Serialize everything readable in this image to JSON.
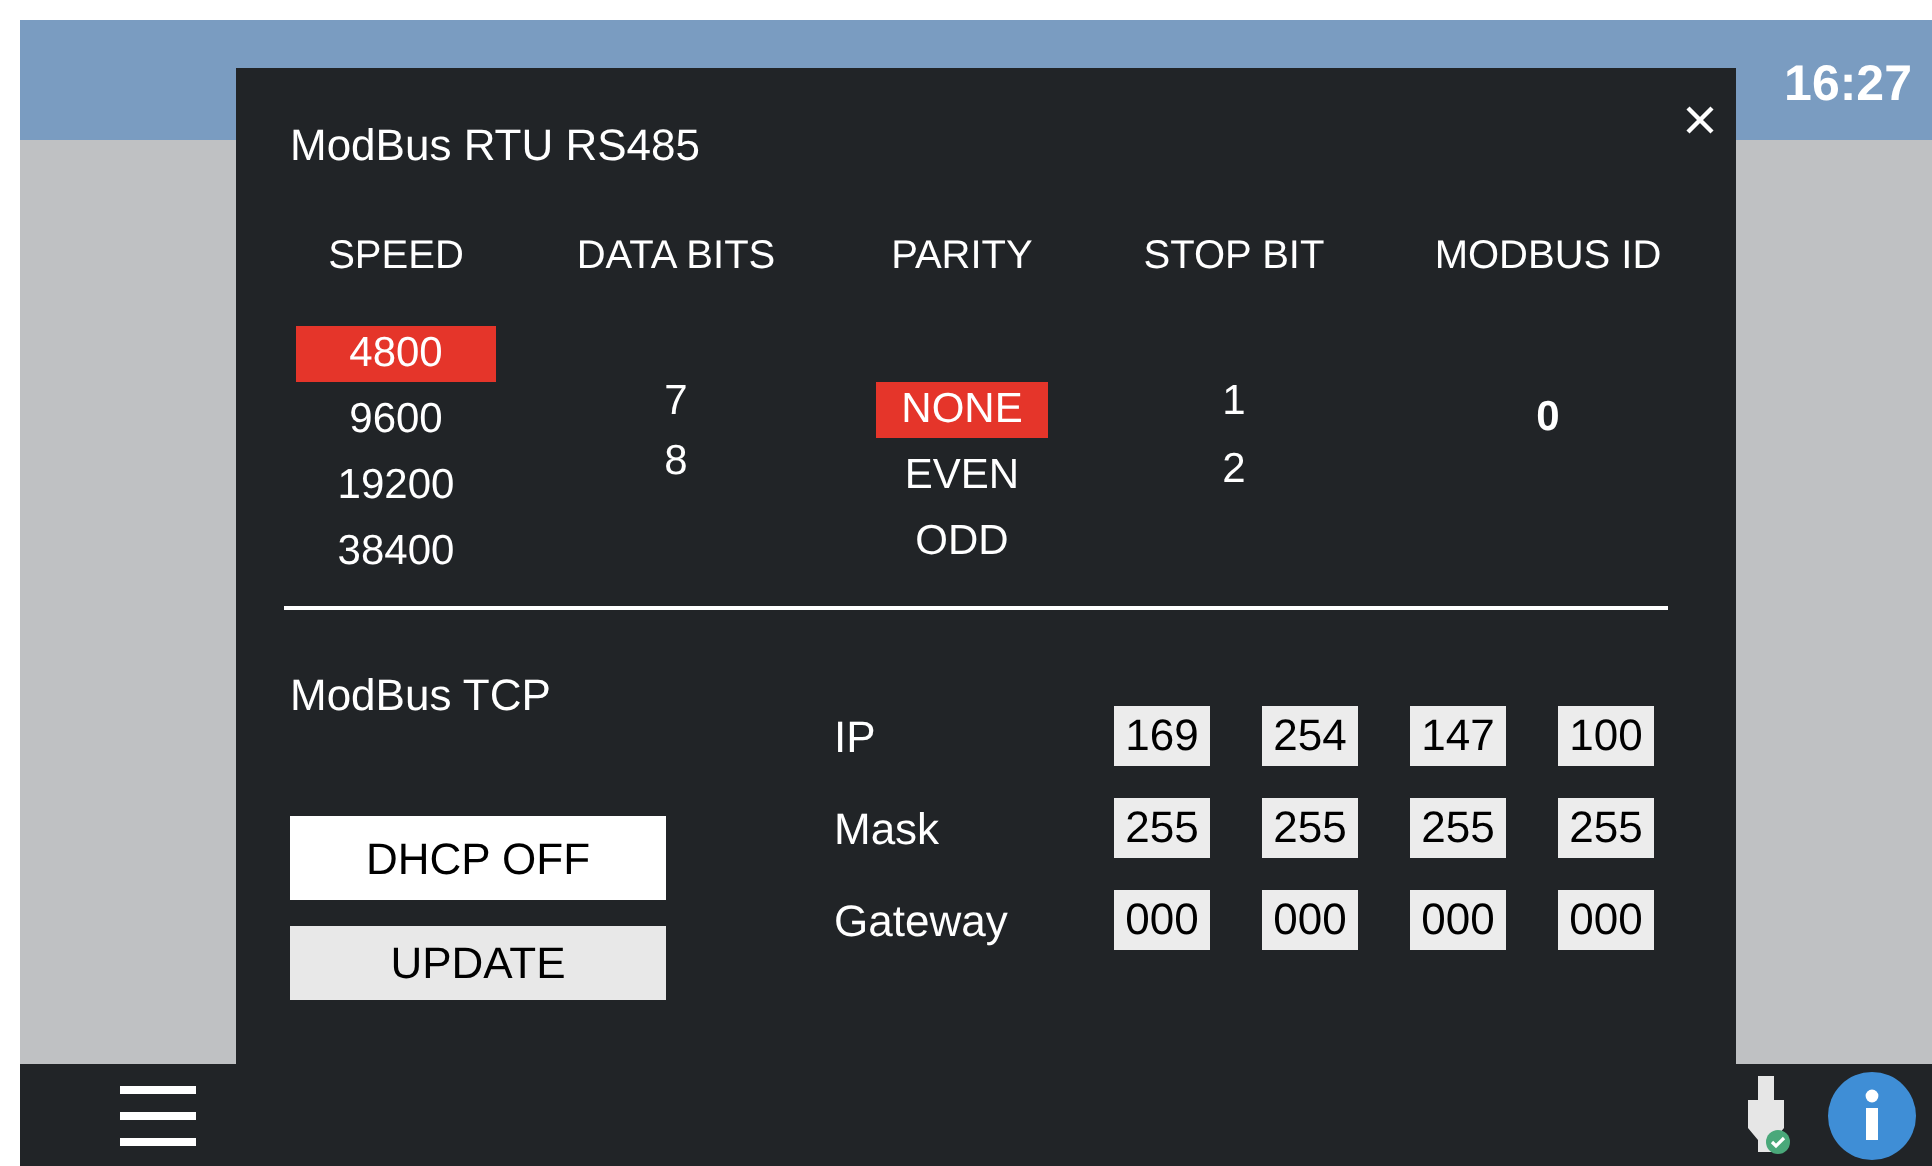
{
  "status_bar": {
    "time": "16:27"
  },
  "dialog": {
    "title": "ModBus RTU RS485",
    "rtu_columns": [
      {
        "header": "SPEED",
        "options": [
          {
            "label": "4800",
            "selected": true
          },
          {
            "label": "9600",
            "selected": false
          },
          {
            "label": "19200",
            "selected": false
          },
          {
            "label": "38400",
            "selected": false
          }
        ]
      },
      {
        "header": "DATA BITS",
        "options": [
          {
            "label": "7",
            "selected": false
          },
          {
            "label": "8",
            "selected": false
          }
        ]
      },
      {
        "header": "PARITY",
        "options": [
          {
            "label": "NONE",
            "selected": true
          },
          {
            "label": "EVEN",
            "selected": false
          },
          {
            "label": "ODD",
            "selected": false
          }
        ]
      },
      {
        "header": "STOP BIT",
        "options": [
          {
            "label": "1",
            "selected": false
          },
          {
            "label": "2",
            "selected": false
          }
        ]
      },
      {
        "header": "MODBUS ID",
        "value": "0"
      }
    ],
    "tcp_title": "ModBus TCP",
    "buttons": [
      "DHCP OFF",
      "UPDATE"
    ],
    "addresses": [
      {
        "label": "IP",
        "octets": [
          "169",
          "254",
          "147",
          "100"
        ]
      },
      {
        "label": "Mask",
        "octets": [
          "255",
          "255",
          "255",
          "255"
        ]
      },
      {
        "label": "Gateway",
        "octets": [
          "000",
          "000",
          "000",
          "000"
        ]
      }
    ]
  }
}
